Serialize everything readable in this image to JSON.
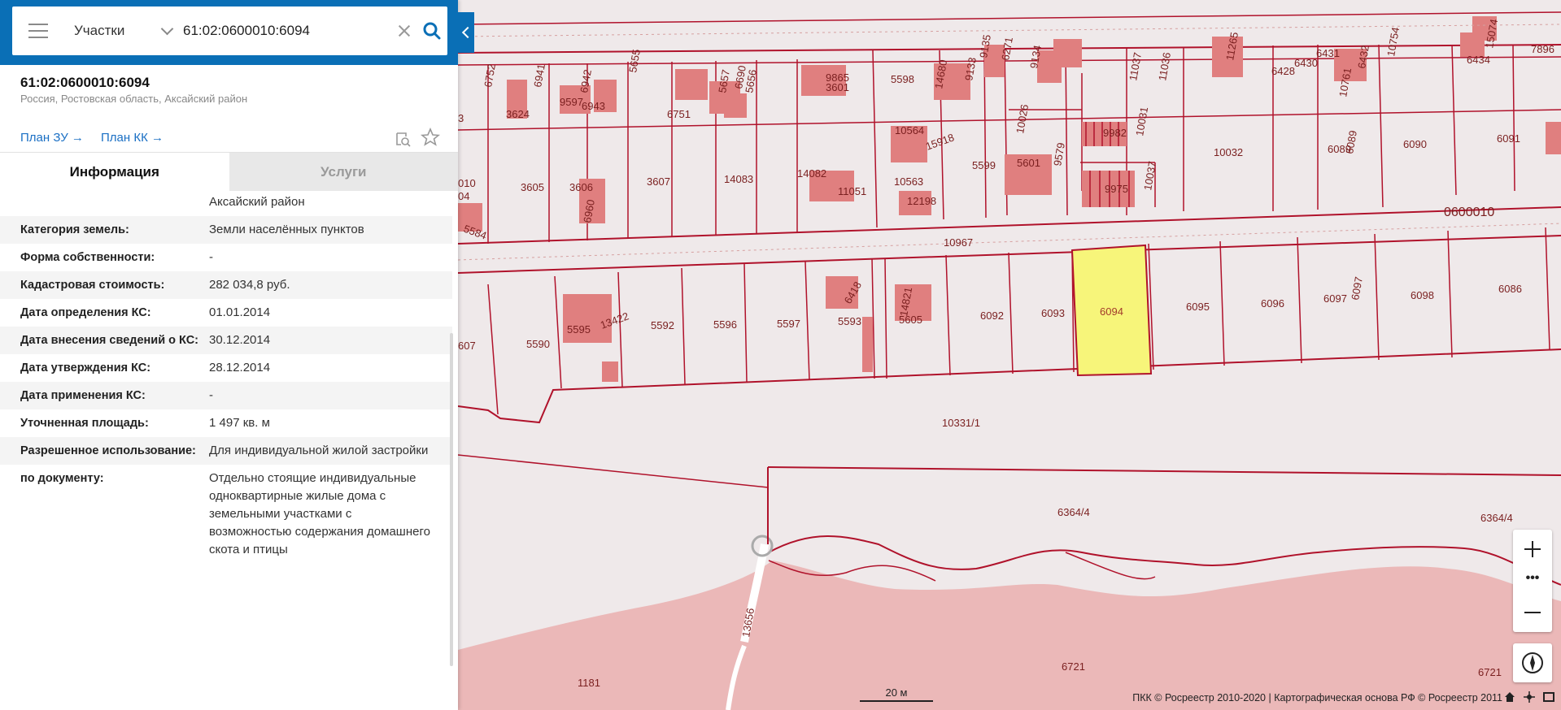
{
  "search": {
    "layer_label": "Участки",
    "query_value": "61:02:0600010:6094"
  },
  "object": {
    "cadastral_number": "61:02:0600010:6094",
    "address": "Россия, Ростовская область, Аксайский район",
    "links": {
      "plan_zu": "План ЗУ →",
      "plan_kk": "План КК →"
    }
  },
  "tabs": {
    "info": "Информация",
    "services": "Услуги"
  },
  "info": {
    "address_tail": "Аксайский район",
    "rows": [
      {
        "label": "Категория земель:",
        "value": "Земли населённых пунктов"
      },
      {
        "label": "Форма собственности:",
        "value": "-"
      },
      {
        "label": "Кадастровая стоимость:",
        "value": "282 034,8 руб."
      },
      {
        "label": "Дата определения КС:",
        "value": "01.01.2014"
      },
      {
        "label": "Дата внесения сведений о КС:",
        "value": "30.12.2014"
      },
      {
        "label": "Дата утверждения КС:",
        "value": "28.12.2014"
      },
      {
        "label": "Дата применения КС:",
        "value": "-"
      },
      {
        "label": "Уточненная площадь:",
        "value": "1 497 кв. м"
      },
      {
        "label": "Разрешенное использование:",
        "value": "Для индивидуальной жилой застройки"
      },
      {
        "label": "по документу:",
        "value": "Отдельно стоящие индивидуальные одноквартирные жилые дома с земельными участками с возможностью содержания домашнего скота и птицы"
      }
    ]
  },
  "map": {
    "quarter": "0600010",
    "selected_plot": "6094",
    "selected_color": "#f7f57a",
    "boundary_color": "#b0122b",
    "building_color": "#e07f7f",
    "plot_labels": {
      "top_row": [
        "6752",
        "3624",
        "6941",
        "9597",
        "6943",
        "6942",
        "5655",
        "6751",
        "5657",
        "6690",
        "5656",
        "9865",
        "3601",
        "5598",
        "14680",
        "9133",
        "9135",
        "6271",
        "9134",
        "6428",
        "11037",
        "11036",
        "6430",
        "11265",
        "6431",
        "10761",
        "6432",
        "10754",
        "6434",
        "15074",
        "7896"
      ],
      "middle_row": [
        "3605",
        "3606",
        "6960",
        "3607",
        "14083",
        "14082",
        "11051",
        "10564",
        "15918",
        "5599",
        "5601",
        "9579",
        "10026",
        "9982",
        "10031",
        "10032",
        "6089",
        "6089",
        "6090",
        "6091",
        "10563",
        "12198",
        "9975",
        "10037",
        "10967"
      ],
      "bottom_row": [
        "5590",
        "5595",
        "13422",
        "5592",
        "5596",
        "5597",
        "5593",
        "6418",
        "5605",
        "14821",
        "6092",
        "6093",
        "6095",
        "6096",
        "6097",
        "6097",
        "6098",
        "6086"
      ],
      "other": [
        "10331/1",
        "6364/4",
        "6364/4",
        "13656",
        "6721",
        "6721",
        "1181",
        "3",
        "010",
        "04",
        "5584",
        "607"
      ]
    },
    "scale_label": "20 м",
    "attribution": "ПКК © Росреестр 2010-2020 | Картографическая основа РФ © Росреестр 2011"
  },
  "icons": {
    "menu": "hamburger-icon",
    "search": "search-icon",
    "clear": "close-icon",
    "map_search": "map-search-icon",
    "favorite": "star-icon",
    "compass": "compass-icon"
  }
}
